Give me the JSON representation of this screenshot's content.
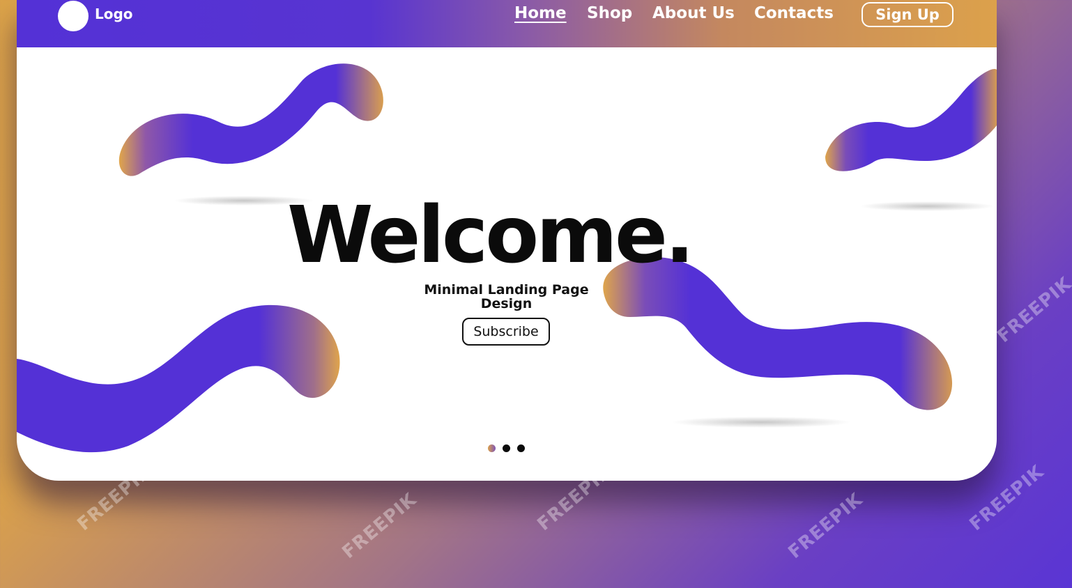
{
  "header": {
    "logo_label": "Logo",
    "nav": [
      {
        "label": "Home",
        "active": true
      },
      {
        "label": "Shop",
        "active": false
      },
      {
        "label": "About Us",
        "active": false
      },
      {
        "label": "Contacts",
        "active": false
      }
    ],
    "signup_label": "Sign Up"
  },
  "hero": {
    "title": "Welcome.",
    "subtitle_line1": "Minimal Landing Page",
    "subtitle_line2": "Design",
    "subscribe_label": "Subscribe"
  },
  "carousel": {
    "slide_count": 3,
    "active_index": 0
  },
  "watermark": "FREEPIK",
  "colors": {
    "purple": "#5431d6",
    "orange": "#dca14b",
    "title": "#0b0b0b",
    "card": "#ffffff"
  },
  "icons": [
    "logo-circle-icon"
  ]
}
